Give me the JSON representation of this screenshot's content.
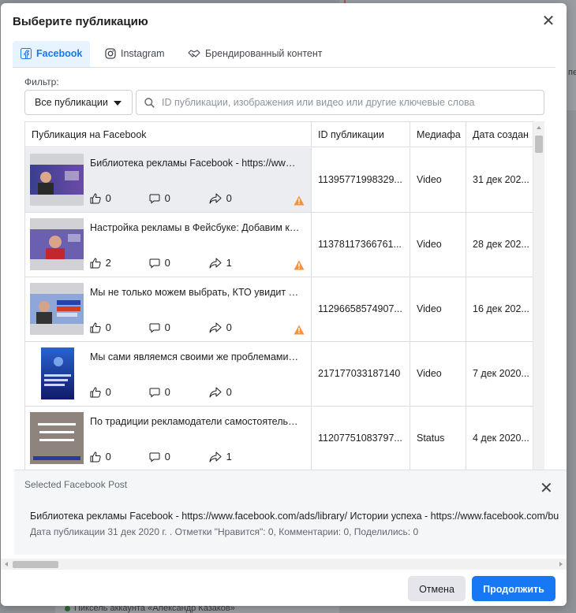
{
  "modal": {
    "title": "Выберите публикацию",
    "tabs": [
      {
        "label": "Facebook",
        "icon": "facebook-icon",
        "active": true
      },
      {
        "label": "Instagram",
        "icon": "instagram-icon",
        "active": false
      },
      {
        "label": "Брендированный контент",
        "icon": "handshake-icon",
        "active": false
      }
    ]
  },
  "filter": {
    "label": "Фильтр:",
    "selected": "Все публикации",
    "search_placeholder": "ID публикации, изображения или видео или другие ключевые слова"
  },
  "table": {
    "columns": [
      "Публикация на Facebook",
      "ID публикации",
      "Медиафа",
      "Дата создан"
    ],
    "rows": [
      {
        "title": "Библиотека рекламы Facebook - https://www.facebook.com/ads/library/",
        "likes": "0",
        "comments": "0",
        "shares": "0",
        "warning": true,
        "id": "11395771998329...",
        "media": "Video",
        "date": "31 дек 202...",
        "selected": true
      },
      {
        "title": "Настройка рекламы в Фейсбуке: Добавим креативности",
        "likes": "2",
        "comments": "0",
        "shares": "1",
        "warning": true,
        "id": "11378117366761...",
        "media": "Video",
        "date": "28 дек 202...",
        "selected": false
      },
      {
        "title": "Мы не только можем выбрать, КТО увидит нашу рекламу",
        "likes": "0",
        "comments": "0",
        "shares": "0",
        "warning": true,
        "id": "11296658574907...",
        "media": "Video",
        "date": "16 дек 202...",
        "selected": false
      },
      {
        "title": "Мы сами являемся своими же проблемами❗...",
        "likes": "0",
        "comments": "0",
        "shares": "0",
        "warning": false,
        "id": "217177033187140",
        "media": "Video",
        "date": "7 дек 2020...",
        "selected": false
      },
      {
        "title": "По традиции рекламодатели самостоятельно выбирают",
        "likes": "0",
        "comments": "0",
        "shares": "1",
        "warning": false,
        "id": "11207751083797...",
        "media": "Status",
        "date": "4 дек 2020...",
        "selected": false
      }
    ]
  },
  "selected_post": {
    "heading": "Selected Facebook Post",
    "description": "Библиотека рекламы Facebook - https://www.facebook.com/ads/library/ Истории успеха - https://www.facebook.com/bu",
    "meta": "Дата публикации 31 дек 2020 г. . Отметки \"Нравится\": 0, Комментарии: 0, Поделились: 0"
  },
  "footer": {
    "cancel_label": "Отмена",
    "continue_label": "Продолжить"
  },
  "background": {
    "bottom_text": "Пиксель аккаунта «Александр Казаков»",
    "right_text": "пе"
  },
  "colors": {
    "accent": "#1877f2",
    "warning": "#f7923b"
  }
}
